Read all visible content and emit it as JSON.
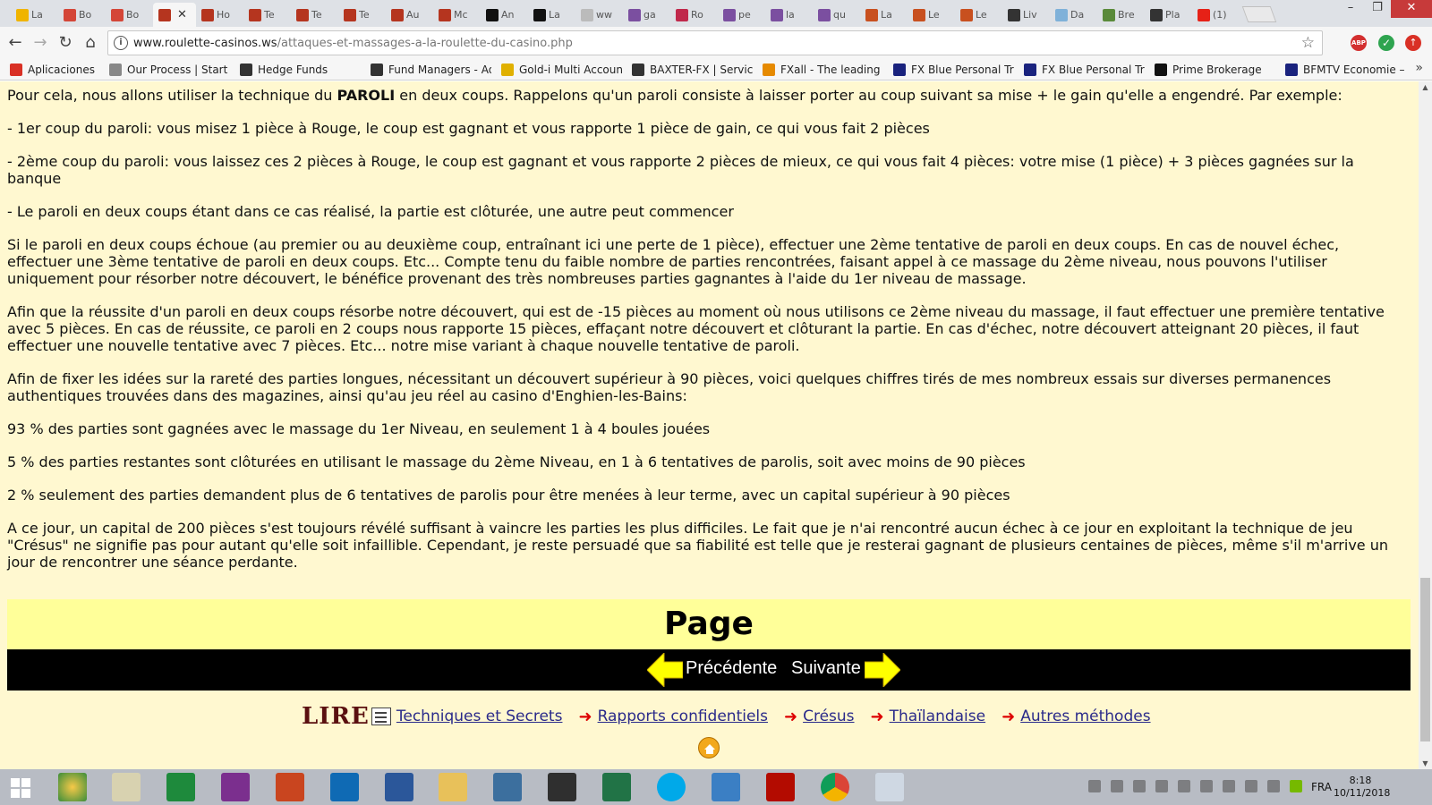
{
  "browser": {
    "tabs": [
      "La",
      "Bo",
      "Bo",
      "",
      "Ho",
      "Te",
      "Te",
      "Te",
      "Au",
      "Mc",
      "An",
      "La",
      "ww",
      "ga",
      "Ro",
      "pe",
      "la",
      "qu",
      "La",
      "Le",
      "Le",
      "Liv",
      "Da",
      "Bre",
      "Pla",
      "(1)"
    ],
    "active_tab_index": 3,
    "url_host": "www.roulette-casinos.ws",
    "url_path": "/attaques-et-massages-a-la-roulette-du-casino.php",
    "bookmarks": [
      "Aplicaciones",
      "Our Process | Start a",
      "Hedge Funds",
      "Fund Managers - Adv",
      "Gold-i Multi Account",
      "BAXTER-FX | Services",
      "FXall - The leading in",
      "FX Blue Personal Trac",
      "FX Blue Personal Trac",
      "Prime Brokerage",
      "BFMTV Economie – la"
    ]
  },
  "article": {
    "p1_pre": "Pour cela, nous allons utiliser la technique du ",
    "p1_bold": "PAROLI",
    "p1_post": " en deux coups. Rappelons qu'un paroli consiste à laisser porter au coup suivant sa mise + le gain qu'elle a engendré. Par exemple:",
    "p2": "- 1er coup du paroli: vous misez 1 pièce à Rouge, le coup est gagnant et vous rapporte 1 pièce de gain, ce qui vous fait 2 pièces",
    "p3": "- 2ème coup du paroli: vous laissez ces 2 pièces à Rouge, le coup est gagnant et vous rapporte 2 pièces de mieux, ce qui vous fait 4 pièces: votre mise (1 pièce) + 3 pièces gagnées sur la banque",
    "p4": "- Le paroli en deux coups étant dans ce cas réalisé, la partie est clôturée, une autre peut commencer",
    "p5": "Si le paroli en deux coups échoue (au premier ou au deuxième coup, entraînant ici une perte de 1 pièce), effectuer une 2ème tentative de paroli en deux coups. En cas de nouvel échec, effectuer une 3ème tentative de paroli en deux coups. Etc... Compte tenu du faible nombre de parties rencontrées, faisant appel à ce massage du 2ème niveau, nous pouvons l'utiliser uniquement pour résorber notre découvert, le bénéfice provenant des très nombreuses parties gagnantes à l'aide du 1er niveau de massage.",
    "p6": "Afin que la réussite d'un paroli en deux coups résorbe notre découvert, qui est de -15 pièces au moment où nous utilisons ce 2ème niveau du massage, il faut effectuer une première tentative avec 5 pièces. En cas de réussite, ce paroli en 2 coups nous rapporte 15 pièces, effaçant notre découvert et clôturant la partie. En cas d'échec, notre découvert atteignant 20 pièces, il faut effectuer une nouvelle tentative avec 7 pièces. Etc... notre mise variant à chaque nouvelle tentative de paroli.",
    "p7": "Afin de fixer les idées sur la rareté des parties longues, nécessitant un découvert supérieur à 90 pièces, voici quelques chiffres tirés de mes nombreux essais sur diverses permanences authentiques trouvées dans des magazines, ainsi qu'au jeu réel au casino d'Enghien-les-Bains:",
    "p8": "93 % des parties sont gagnées avec le massage du 1er Niveau, en seulement 1 à 4 boules jouées",
    "p9": "5 % des parties restantes sont clôturées en utilisant le massage du 2ème Niveau, en 1 à 6 tentatives de parolis, soit avec moins de 90 pièces",
    "p10": "2 % seulement des parties demandent plus de 6 tentatives de parolis pour être menées à leur terme, avec un capital supérieur à 90 pièces",
    "p11": "A ce jour, un capital de 200 pièces s'est toujours révélé suffisant à vaincre les parties les plus difficiles. Le fait que je n'ai rencontré aucun échec à ce jour en exploitant la technique de jeu \"Crésus\" ne signifie pas pour autant qu'elle soit infaillible. Cependant, je reste persuadé que sa fiabilité est telle que je resterai gagnant de plusieurs centaines de pièces, même s'il m'arrive un jour de rencontrer une séance perdante."
  },
  "pager": {
    "title": "Page",
    "prev": "Précédente",
    "next": "Suivante"
  },
  "footer": {
    "lire": "LIRE",
    "links": [
      "Techniques et Secrets",
      "Rapports confidentiels",
      "Crésus",
      "Thaïlandaise",
      "Autres méthodes"
    ]
  },
  "system": {
    "lang": "FRA",
    "time": "8:18",
    "date": "10/11/2018"
  },
  "colors": {
    "page_bg": "#fff8d0",
    "pager_bg": "#ffff99",
    "arrow": "#ffff00",
    "link": "#2a2a8a"
  }
}
